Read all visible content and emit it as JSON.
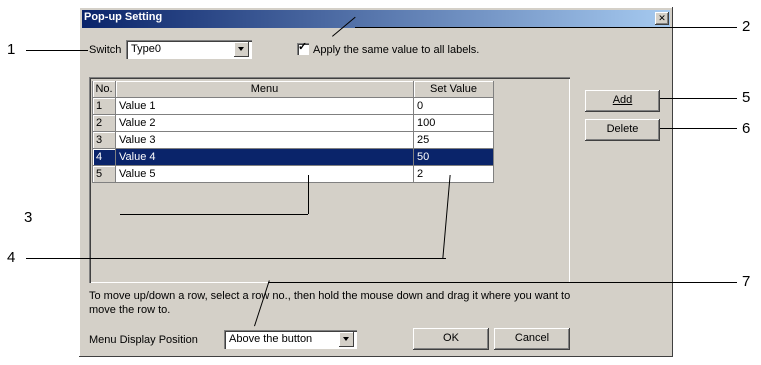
{
  "window": {
    "title": "Pop-up Setting",
    "close_glyph": "✕"
  },
  "switch": {
    "label": "Switch",
    "value": "Type0"
  },
  "apply_same": {
    "label": "Apply the same value to all labels.",
    "checked": true
  },
  "table": {
    "headers": {
      "no": "No.",
      "menu": "Menu",
      "value": "Set Value"
    },
    "rows": [
      {
        "no": "1",
        "menu": "Value 1",
        "value": "0"
      },
      {
        "no": "2",
        "menu": "Value 2",
        "value": "100"
      },
      {
        "no": "3",
        "menu": "Value 3",
        "value": "25"
      },
      {
        "no": "4",
        "menu": "Value 4",
        "value": "50",
        "selected": true
      },
      {
        "no": "5",
        "menu": "Value 5",
        "value": "2"
      }
    ]
  },
  "buttons": {
    "add": "Add",
    "delete": "Delete",
    "ok": "OK",
    "cancel": "Cancel"
  },
  "instructions": {
    "line1": "To move up/down a row, select a row no., then hold the mouse down and drag it where you want to",
    "line2": "move the row to."
  },
  "menu_position": {
    "label": "Menu Display Position",
    "value": "Above the button"
  },
  "callouts": {
    "c1": "1",
    "c2": "2",
    "c3": "3",
    "c4": "4",
    "c5": "5",
    "c6": "6",
    "c7": "7"
  },
  "colors": {
    "selection": "#0a246a",
    "title_start": "#0a246a",
    "title_end": "#a6caf0",
    "face": "#d4d0c8"
  }
}
